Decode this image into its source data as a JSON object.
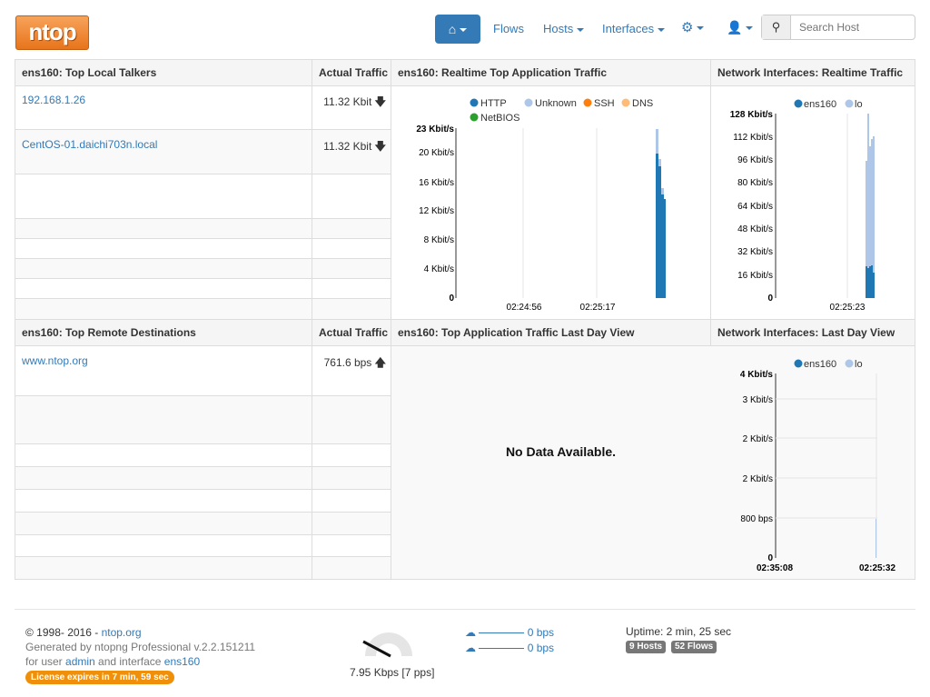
{
  "nav": {
    "logo": "ntop",
    "flows": "Flows",
    "hosts": "Hosts",
    "interfaces": "Interfaces",
    "search_placeholder": "Search Host"
  },
  "local_talkers": {
    "title": "ens160: Top Local Talkers",
    "col_traffic": "Actual Traffic",
    "rows": [
      {
        "host": "192.168.1.26",
        "traffic": "11.32 Kbit"
      },
      {
        "host": "CentOS-01.daichi703n.local",
        "traffic": "11.32 Kbit"
      }
    ]
  },
  "app_realtime": {
    "title": "ens160: Realtime Top Application Traffic",
    "legend": [
      "HTTP",
      "Unknown",
      "SSH",
      "DNS",
      "NetBIOS"
    ],
    "legend_colors": [
      "#1f77b4",
      "#aec7e8",
      "#ff7f0e",
      "#ffbb78",
      "#2ca02c"
    ],
    "yticks": [
      "23 Kbit/s",
      "20 Kbit/s",
      "16 Kbit/s",
      "12 Kbit/s",
      "8 Kbit/s",
      "4 Kbit/s",
      "0"
    ],
    "xticks": [
      "02:24:56",
      "02:25:17"
    ]
  },
  "net_realtime": {
    "title": "Network Interfaces: Realtime Traffic",
    "legend": [
      "ens160",
      "lo"
    ],
    "legend_colors": [
      "#1f77b4",
      "#aec7e8"
    ],
    "yticks": [
      "128 Kbit/s",
      "112 Kbit/s",
      "96 Kbit/s",
      "80 Kbit/s",
      "64 Kbit/s",
      "48 Kbit/s",
      "32 Kbit/s",
      "16 Kbit/s",
      "0"
    ],
    "xticks": [
      "02:25:23"
    ]
  },
  "remote_dest": {
    "title": "ens160: Top Remote Destinations",
    "col_traffic": "Actual Traffic",
    "rows": [
      {
        "host": "www.ntop.org",
        "traffic": "761.6 bps"
      }
    ]
  },
  "app_lastday": {
    "title": "ens160: Top Application Traffic Last Day View",
    "empty": "No Data Available."
  },
  "net_lastday": {
    "title": "Network Interfaces: Last Day View",
    "legend": [
      "ens160",
      "lo"
    ],
    "yticks": [
      "4 Kbit/s",
      "3 Kbit/s",
      "2 Kbit/s",
      "2 Kbit/s",
      "800 bps",
      "0"
    ],
    "xticks": [
      "02:35:08",
      "02:25:32"
    ]
  },
  "footer": {
    "copyright": "© 1998- 2016 - ",
    "copyright_link": "ntop.org",
    "generated": "Generated by ntopng Professional v.2.2.151211",
    "for_user": "for user ",
    "user": "admin",
    "and_interface": " and interface ",
    "interface": "ens160",
    "license": "License expires in 7 min, 59 sec",
    "gauge_label": "7.95 Kbps [7 pps]",
    "upload": "0 bps",
    "download": "0 bps",
    "uptime": "Uptime: 2 min, 25 sec",
    "hosts_badge": "9 Hosts",
    "flows_badge": "52 Flows"
  }
}
